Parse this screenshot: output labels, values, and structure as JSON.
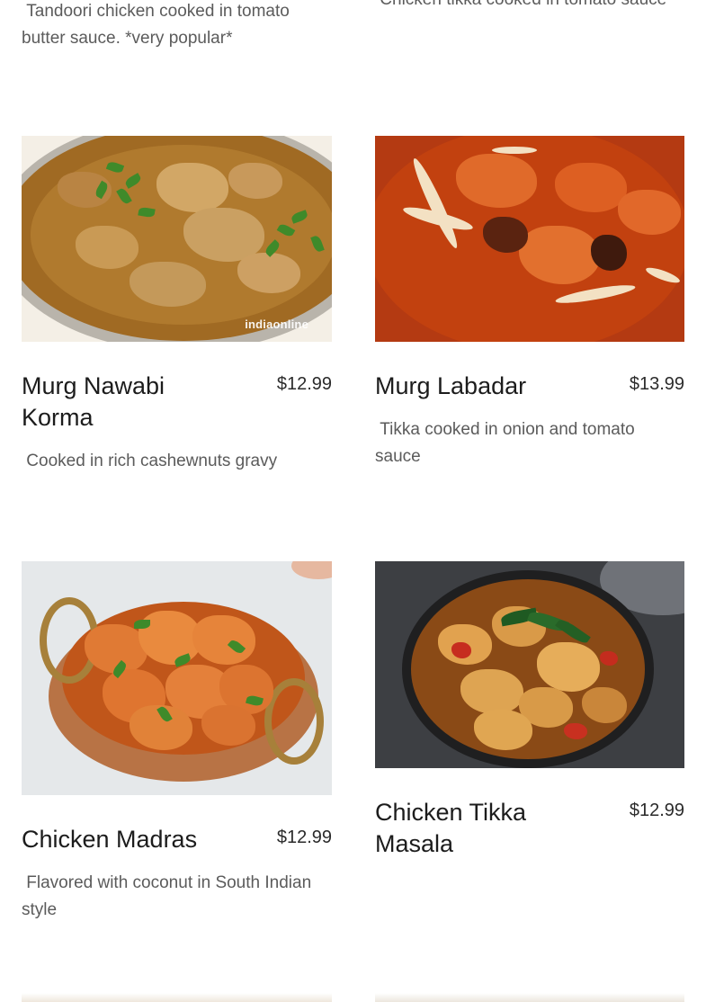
{
  "top_partial": {
    "left_desc": " Tandoori chicken cooked in tomato butter sauce. *very popular*",
    "right_desc": " Chicken tikka cooked in tomato sauce"
  },
  "items": [
    {
      "name": "Murg Nawabi Korma",
      "price": "$12.99",
      "desc": " Cooked in rich cashewnuts gravy",
      "photo_watermark": "indiaonline"
    },
    {
      "name": "Murg Labadar",
      "price": "$13.99",
      "desc": " Tikka cooked in onion and tomato sauce"
    },
    {
      "name": "Chicken Madras",
      "price": "$12.99",
      "desc": " Flavored with coconut in South Indian style"
    },
    {
      "name": "Chicken Tikka Masala",
      "price": "$12.99",
      "desc": ""
    }
  ],
  "colors": {
    "desc_text": "#5b5b5b",
    "name_text": "#1c1c1c",
    "background": "#ffffff"
  }
}
